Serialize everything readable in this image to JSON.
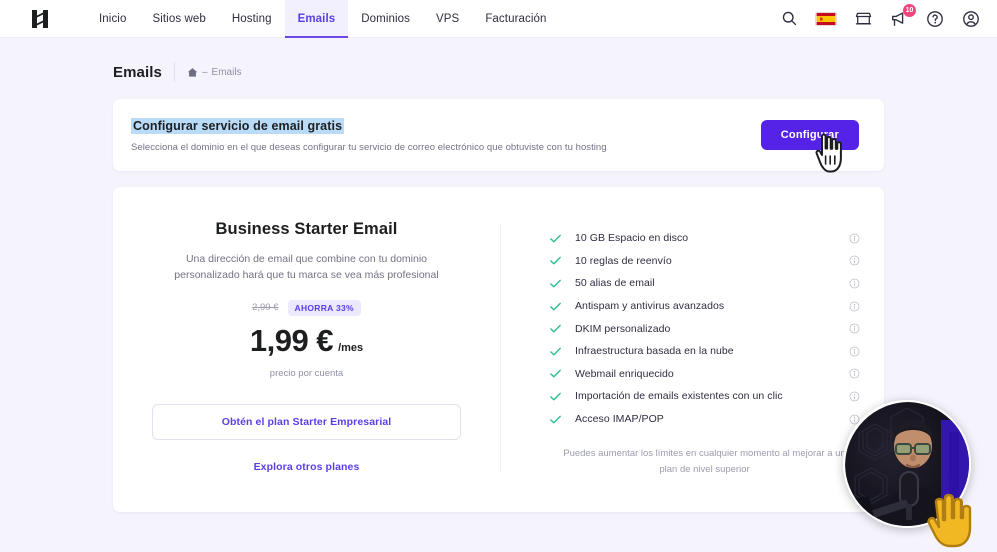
{
  "nav": {
    "logo_icon": "hostinger-h-logo",
    "links": [
      {
        "label": "Inicio",
        "active": false
      },
      {
        "label": "Sitios web",
        "active": false
      },
      {
        "label": "Hosting",
        "active": false
      },
      {
        "label": "Emails",
        "active": true
      },
      {
        "label": "Dominios",
        "active": false
      },
      {
        "label": "VPS",
        "active": false
      },
      {
        "label": "Facturación",
        "active": false
      }
    ],
    "icons": [
      {
        "name": "search-icon"
      },
      {
        "name": "spain-flag-icon"
      },
      {
        "name": "store-icon"
      },
      {
        "name": "announcements-megaphone-icon",
        "badge": "10"
      },
      {
        "name": "help-question-icon"
      },
      {
        "name": "account-avatar-icon"
      }
    ]
  },
  "page": {
    "title": "Emails",
    "breadcrumb": {
      "home_icon": "home-icon",
      "separator": "–",
      "current": "Emails"
    }
  },
  "banner": {
    "title": "Configurar servicio de email gratis",
    "subtitle": "Selecciona el dominio en el que deseas configurar tu servicio de correo electrónico que obtuviste con tu hosting",
    "button_label": "Configurar",
    "button_color": "#5423e7",
    "title_highlight_color": "#b9dbf8"
  },
  "plan": {
    "name": "Business Starter Email",
    "description": "Una dirección de email que combine con tu dominio personalizado hará que tu marca se vea más profesional",
    "old_price": "2,99 €",
    "save_badge": "AHORRA 33%",
    "price_amount": "1,99 €",
    "price_period": "/mes",
    "price_note": "precio por cuenta",
    "cta_outline_label": "Obtén el plan Starter Empresarial",
    "cta_link_label": "Explora otros planes",
    "accent_color": "#5b3ee8"
  },
  "features": {
    "check_color": "#2bbf8a",
    "items": [
      "10 GB Espacio en disco",
      "10 reglas de reenvío",
      "50 alias de email",
      "Antispam y antivirus avanzados",
      "DKIM personalizado",
      "Infraestructura basada en la nube",
      "Webmail enriquecido",
      "Importación de emails existentes con un clic",
      "Acceso IMAP/POP"
    ],
    "info_icon": "info-circle-icon",
    "note": "Puedes aumentar los límites en cualquier momento al mejorar a un plan de nivel superior"
  },
  "overlay": {
    "cursor_icon": "hand-pointer-cursor",
    "webcam_label": "presenter-webcam-bubble",
    "emoji_icon": "pointing-hand-emoji"
  }
}
